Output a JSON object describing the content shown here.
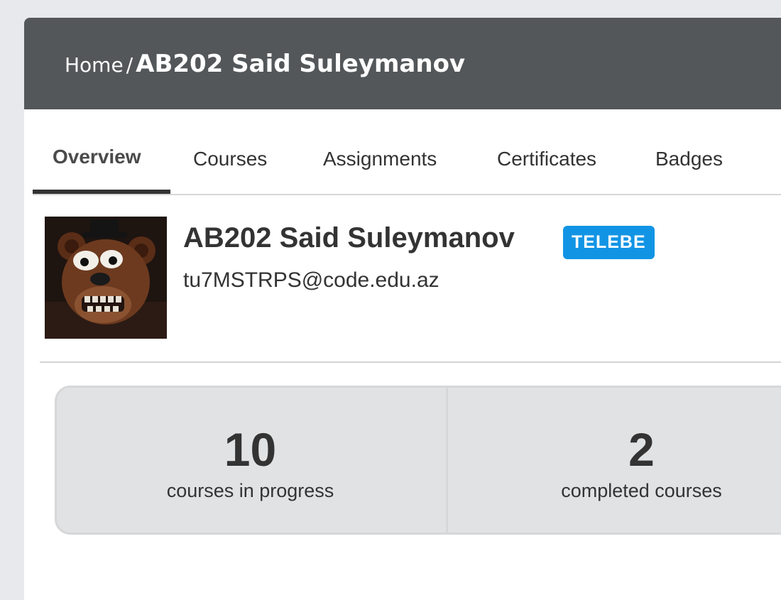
{
  "breadcrumb": {
    "home": "Home",
    "separator": "/",
    "current": "AB202 Said Suleymanov"
  },
  "tabs": [
    {
      "label": "Overview",
      "active": true
    },
    {
      "label": "Courses",
      "active": false
    },
    {
      "label": "Assignments",
      "active": false
    },
    {
      "label": "Certificates",
      "active": false
    },
    {
      "label": "Badges",
      "active": false
    }
  ],
  "profile": {
    "name": "AB202 Said Suleymanov",
    "role_badge": "TELEBE",
    "email": "tu7MSTRPS@code.edu.az",
    "avatar_icon": "animatronic-bear-avatar"
  },
  "stats": [
    {
      "value": "10",
      "label": "courses in progress"
    },
    {
      "value": "2",
      "label": "completed courses"
    }
  ],
  "colors": {
    "header": "#535759",
    "badge": "#1294e5",
    "background": "#e7e9ec",
    "stats_bg": "#e1e2e4"
  }
}
